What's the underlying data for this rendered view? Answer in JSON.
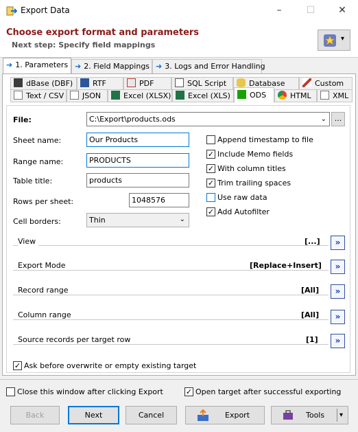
{
  "window": {
    "title": "Export Data",
    "minimize_glyph": "–",
    "maximize_glyph": "☐",
    "close_glyph": "✕"
  },
  "header": {
    "heading": "Choose export format and parameters",
    "subheading": "Next step: Specify field mappings",
    "favorites_icon": "star-icon",
    "dropdown_glyph": "▾"
  },
  "step_tabs": [
    {
      "label": "1. Parameters",
      "icon": "arrow-right-icon"
    },
    {
      "label": "2. Field Mappings",
      "icon": "arrow-right-icon"
    },
    {
      "label": "3. Logs and Error Handling",
      "icon": "arrow-right-icon"
    }
  ],
  "format_tabs_row1": [
    {
      "label": "dBase (DBF)",
      "icon": "dbase-icon"
    },
    {
      "label": "RTF",
      "icon": "word-icon"
    },
    {
      "label": "PDF",
      "icon": "pdf-icon"
    },
    {
      "label": "SQL Script",
      "icon": "sql-script-icon"
    },
    {
      "label": "Database",
      "icon": "database-icon"
    },
    {
      "label": "Custom",
      "icon": "pen-icon"
    }
  ],
  "format_tabs_row2": [
    {
      "label": "Text / CSV",
      "icon": "text-icon"
    },
    {
      "label": "JSON",
      "icon": "json-icon"
    },
    {
      "label": "Excel (XLSX)",
      "icon": "excel-icon"
    },
    {
      "label": "Excel (XLS)",
      "icon": "excel-icon"
    },
    {
      "label": "ODS",
      "icon": "ods-icon",
      "active": true
    },
    {
      "label": "HTML",
      "icon": "chrome-icon"
    },
    {
      "label": "XML",
      "icon": "xml-icon"
    }
  ],
  "form": {
    "file_label": "File:",
    "file_value": "C:\\Export\\products.ods",
    "browse_label": "...",
    "sheet_name_label": "Sheet name:",
    "sheet_name_value": "Our Products",
    "range_name_label": "Range name:",
    "range_name_value": "PRODUCTS",
    "table_title_label": "Table title:",
    "table_title_value": "products",
    "rows_per_sheet_label": "Rows per sheet:",
    "rows_per_sheet_value": "1048576",
    "cell_borders_label": "Cell borders:",
    "cell_borders_value": "Thin"
  },
  "options": [
    {
      "label": "Append timestamp to file",
      "checked": false
    },
    {
      "label": "Include Memo fields",
      "checked": true
    },
    {
      "label": "With column titles",
      "checked": true
    },
    {
      "label": "Trim trailing spaces",
      "checked": true
    },
    {
      "label": "Use raw data",
      "checked": false
    },
    {
      "label": "Add Autofilter",
      "checked": true
    }
  ],
  "sections": [
    {
      "label": "View",
      "value": "[...]"
    },
    {
      "label": "Export Mode",
      "value": "[Replace+Insert]"
    },
    {
      "label": "Record range",
      "value": "[All]"
    },
    {
      "label": "Column range",
      "value": "[All]"
    },
    {
      "label": "Source records per target row",
      "value": "[1]"
    }
  ],
  "go_glyph": "»",
  "ask_overwrite": {
    "label": "Ask before overwrite or empty existing target",
    "checked": true
  },
  "footer": {
    "close_after_export": {
      "label": "Close this window after clicking Export",
      "checked": false
    },
    "open_target": {
      "label": "Open target after successful exporting",
      "checked": true
    },
    "buttons": {
      "back": "Back",
      "next": "Next",
      "cancel": "Cancel",
      "export": "Export",
      "tools": "Tools"
    }
  },
  "colors": {
    "heading": "#8b1a1a",
    "accent": "#0078d7",
    "tab_arrow": "#1a6fd0"
  }
}
